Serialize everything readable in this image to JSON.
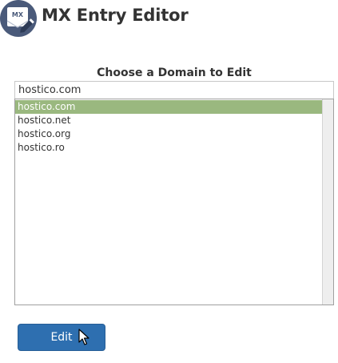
{
  "header": {
    "icon_name": "mail-edit-icon",
    "icon_text": "MX",
    "title": "MX Entry Editor"
  },
  "domain_picker": {
    "label": "Choose a Domain to Edit",
    "input_value": "hostico.com",
    "items": [
      {
        "label": "hostico.com",
        "selected": true
      },
      {
        "label": "hostico.net",
        "selected": false
      },
      {
        "label": "hostico.org",
        "selected": false
      },
      {
        "label": "hostico.ro",
        "selected": false
      }
    ]
  },
  "actions": {
    "edit_label": "Edit"
  },
  "colors": {
    "selection": "#9ab87f",
    "button": "#2e6fb0",
    "icon_circle": "#4a5a7a"
  }
}
